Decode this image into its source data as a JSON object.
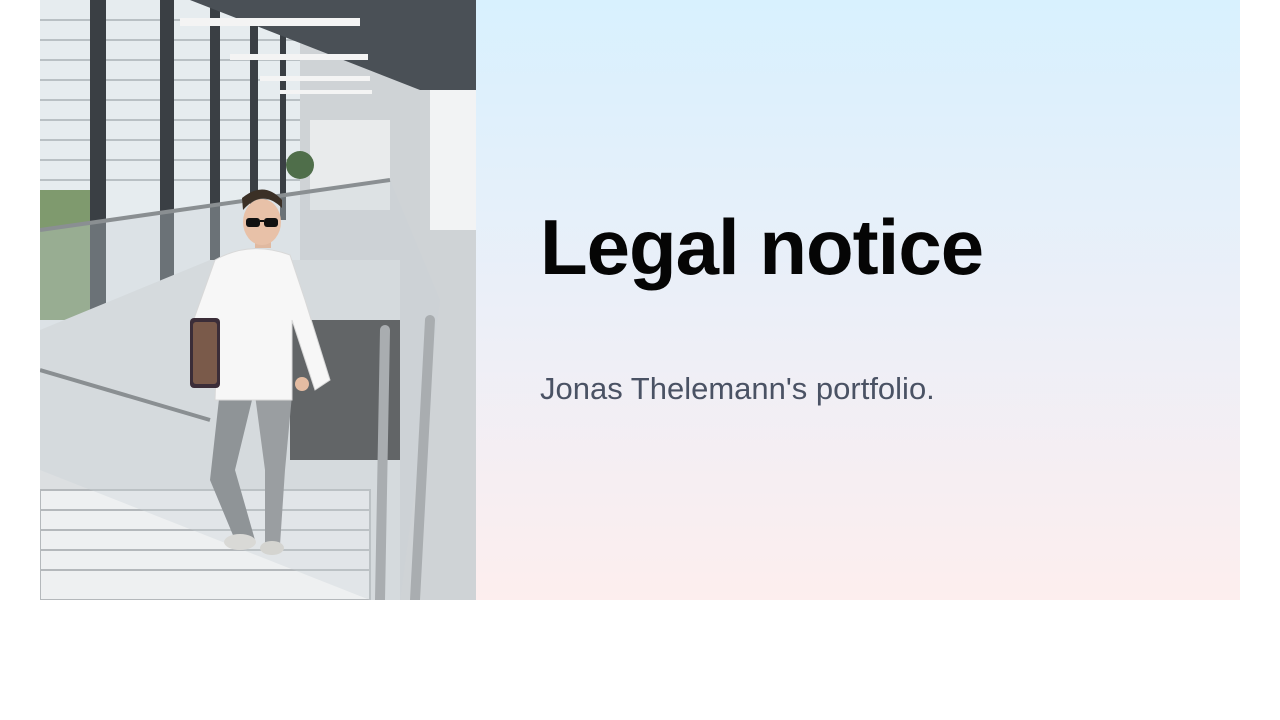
{
  "hero": {
    "title": "Legal notice",
    "subtitle": "Jonas Thelemann's portfolio."
  },
  "photo": {
    "content": "person-walking-up-stairs"
  },
  "colors": {
    "title": "#050505",
    "subtitle": "#4a5264",
    "gradient_top": "#d8f1fe",
    "gradient_bottom": "#fdeeee"
  }
}
